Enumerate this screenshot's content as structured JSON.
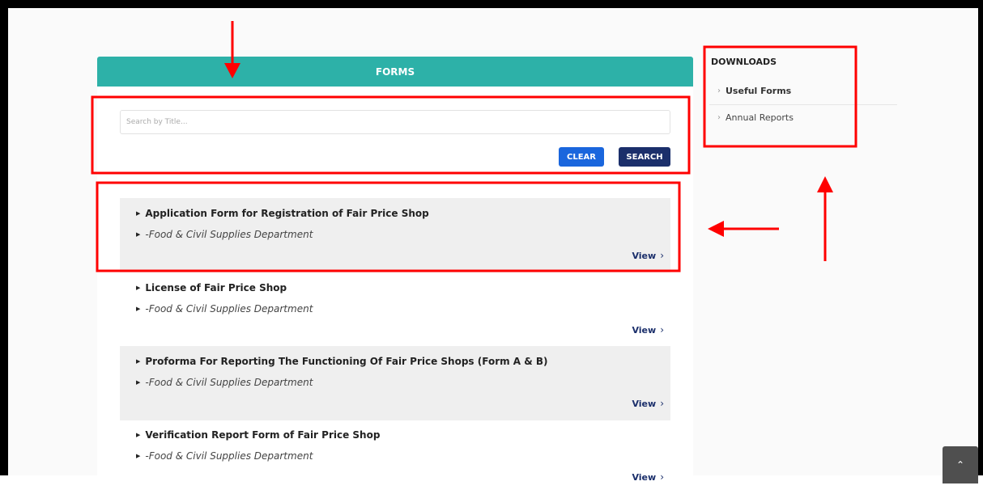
{
  "forms_panel": {
    "header": "FORMS",
    "search_placeholder": "Search by Title...",
    "clear_label": "CLEAR",
    "search_label": "SEARCH"
  },
  "form_items": [
    {
      "title": "Application Form for Registration of Fair Price Shop",
      "department": "-Food & Civil Supplies Department",
      "view_label": "View"
    },
    {
      "title": "License of Fair Price Shop",
      "department": "-Food & Civil Supplies Department",
      "view_label": "View"
    },
    {
      "title": "Proforma For Reporting The Functioning Of Fair Price Shops (Form A & B)",
      "department": "-Food & Civil Supplies Department",
      "view_label": "View"
    },
    {
      "title": "Verification Report Form of Fair Price Shop",
      "department": "-Food & Civil Supplies Department",
      "view_label": "View"
    }
  ],
  "downloads": {
    "title": "DOWNLOADS",
    "items": [
      {
        "label": "Useful Forms",
        "active": true
      },
      {
        "label": "Annual Reports",
        "active": false
      }
    ]
  },
  "icons": {
    "bullet": "triangle-right-icon",
    "view": "chevron-right-icon",
    "scroll_top": "chevron-up-icon"
  },
  "colors": {
    "header_teal": "#2db1a8",
    "clear_button": "#1a66dd",
    "search_button": "#1b2f6b",
    "annotation_red": "#ff0000"
  }
}
